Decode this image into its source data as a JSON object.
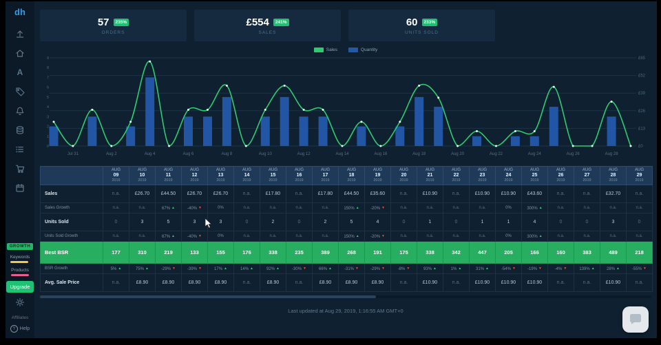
{
  "app": {
    "logo_text": "dh"
  },
  "sidebar": {
    "icons": [
      {
        "name": "upload-icon"
      },
      {
        "name": "home-icon"
      },
      {
        "name": "typography-icon"
      },
      {
        "name": "tag-icon"
      },
      {
        "name": "bell-icon"
      },
      {
        "name": "database-icon"
      },
      {
        "name": "list-icon"
      },
      {
        "name": "cart-icon"
      },
      {
        "name": "calendar-icon"
      }
    ],
    "growth_label": "GROWTH",
    "keywords_label": "Keywords",
    "products_label": "Products",
    "upgrade_label": "Upgrade",
    "affiliates_label": "Affiliates",
    "help_label": "Help"
  },
  "kpis": [
    {
      "value": "57",
      "badge": "235%",
      "label": "ORDERS"
    },
    {
      "value": "£554",
      "badge": "241%",
      "label": "SALES"
    },
    {
      "value": "60",
      "badge": "233%",
      "label": "UNITS SOLD"
    }
  ],
  "chart_data": {
    "type": "bar",
    "x": [
      "Jul 30",
      "Jul 31",
      "Aug 1",
      "Aug 2",
      "Aug 3",
      "Aug 4",
      "Aug 5",
      "Aug 6",
      "Aug 7",
      "Aug 8",
      "Aug 9",
      "Aug 10",
      "Aug 11",
      "Aug 12",
      "Aug 13",
      "Aug 14",
      "Aug 15",
      "Aug 16",
      "Aug 17",
      "Aug 18",
      "Aug 19",
      "Aug 20",
      "Aug 21",
      "Aug 22",
      "Aug 23",
      "Aug 24",
      "Aug 25",
      "Aug 26",
      "Aug 27",
      "Aug 28",
      "Aug 29"
    ],
    "x_ticks_shown": [
      "Jul 31",
      "Aug 2",
      "Aug 4",
      "Aug 6",
      "Aug 8",
      "Aug 10",
      "Aug 12",
      "Aug 14",
      "Aug 16",
      "Aug 18",
      "Aug 20",
      "Aug 22",
      "Aug 24",
      "Aug 26",
      "Aug 28"
    ],
    "series": [
      {
        "name": "Sales",
        "type": "line",
        "color": "#2ecc71",
        "values": [
          17.8,
          0,
          26.7,
          0,
          17.8,
          62.3,
          0,
          26.7,
          26.7,
          44.5,
          0,
          26.7,
          44.5,
          26.7,
          26.7,
          0,
          17.8,
          0,
          17.8,
          44.5,
          35.6,
          0,
          10.9,
          0,
          10.9,
          10.9,
          43.6,
          0,
          0,
          32.7,
          0
        ]
      },
      {
        "name": "Quantity",
        "type": "bar",
        "color": "#2459aa",
        "values": [
          2,
          0,
          3,
          0,
          2,
          7,
          0,
          3,
          3,
          5,
          0,
          3,
          5,
          3,
          3,
          0,
          2,
          0,
          2,
          5,
          4,
          0,
          1,
          0,
          1,
          1,
          4,
          0,
          0,
          3,
          0
        ]
      }
    ],
    "left_axis": {
      "min": 0,
      "max": 9,
      "ticks": [
        0,
        1,
        2,
        3,
        4,
        5,
        6,
        7,
        8,
        9
      ]
    },
    "right_axis": {
      "min": 0,
      "max": 65,
      "ticks": [
        0,
        13,
        26,
        39,
        52,
        65
      ],
      "prefix": "£"
    },
    "grid": true,
    "legend_position": "top"
  },
  "table": {
    "month": "AUG",
    "year": "2019",
    "dates": [
      "09",
      "10",
      "11",
      "12",
      "13",
      "14",
      "15",
      "16",
      "17",
      "18",
      "19",
      "20",
      "21",
      "22",
      "23",
      "24",
      "25",
      "26",
      "27",
      "28",
      "29"
    ],
    "rows": [
      {
        "label": "Sales",
        "type": "main",
        "cells": [
          {
            "t": "n.a."
          },
          {
            "t": "£26.70"
          },
          {
            "t": "£44.50"
          },
          {
            "t": "£26.70"
          },
          {
            "t": "£26.70"
          },
          {
            "t": "n.a."
          },
          {
            "t": "£17.80"
          },
          {
            "t": "n.a."
          },
          {
            "t": "£17.80"
          },
          {
            "t": "£44.50"
          },
          {
            "t": "£35.60"
          },
          {
            "t": "n.a."
          },
          {
            "t": "£10.90"
          },
          {
            "t": "n.a."
          },
          {
            "t": "£10.90"
          },
          {
            "t": "£10.90"
          },
          {
            "t": "£43.60"
          },
          {
            "t": "n.a."
          },
          {
            "t": "n.a."
          },
          {
            "t": "£32.70"
          },
          {
            "t": "n.a."
          }
        ]
      },
      {
        "label": "Sales Growth",
        "type": "growth",
        "cells": [
          {
            "t": "n.a."
          },
          {
            "t": "n.a."
          },
          {
            "t": "67%",
            "a": "up"
          },
          {
            "t": "-40%",
            "a": "down"
          },
          {
            "t": "0%"
          },
          {
            "t": "n.a."
          },
          {
            "t": "n.a."
          },
          {
            "t": "n.a."
          },
          {
            "t": "n.a."
          },
          {
            "t": "150%",
            "a": "up"
          },
          {
            "t": "-20%",
            "a": "down"
          },
          {
            "t": "n.a."
          },
          {
            "t": "n.a."
          },
          {
            "t": "n.a."
          },
          {
            "t": "n.a."
          },
          {
            "t": "0%"
          },
          {
            "t": "300%",
            "a": "up"
          },
          {
            "t": "n.a."
          },
          {
            "t": "n.a."
          },
          {
            "t": "n.a."
          },
          {
            "t": "n.a."
          }
        ]
      },
      {
        "label": "Units Sold",
        "type": "main",
        "cells": [
          {
            "t": "0"
          },
          {
            "t": "3"
          },
          {
            "t": "5"
          },
          {
            "t": "3"
          },
          {
            "t": "3"
          },
          {
            "t": "0"
          },
          {
            "t": "2"
          },
          {
            "t": "0"
          },
          {
            "t": "2"
          },
          {
            "t": "5"
          },
          {
            "t": "4"
          },
          {
            "t": "0"
          },
          {
            "t": "1"
          },
          {
            "t": "0"
          },
          {
            "t": "1"
          },
          {
            "t": "1"
          },
          {
            "t": "4"
          },
          {
            "t": "0"
          },
          {
            "t": "0"
          },
          {
            "t": "3"
          },
          {
            "t": "0"
          }
        ]
      },
      {
        "label": "Units Sold Growth",
        "type": "growth",
        "cells": [
          {
            "t": "n.a."
          },
          {
            "t": "n.a."
          },
          {
            "t": "67%",
            "a": "up"
          },
          {
            "t": "-40%",
            "a": "down"
          },
          {
            "t": "0%"
          },
          {
            "t": "n.a."
          },
          {
            "t": "n.a."
          },
          {
            "t": "n.a."
          },
          {
            "t": "n.a."
          },
          {
            "t": "150%",
            "a": "up"
          },
          {
            "t": "-20%",
            "a": "down"
          },
          {
            "t": "n.a."
          },
          {
            "t": "n.a."
          },
          {
            "t": "n.a."
          },
          {
            "t": "n.a."
          },
          {
            "t": "0%"
          },
          {
            "t": "300%",
            "a": "up"
          },
          {
            "t": "n.a."
          },
          {
            "t": "n.a."
          },
          {
            "t": "n.a."
          },
          {
            "t": "n.a."
          }
        ]
      },
      {
        "label": "Best BSR",
        "type": "bsr",
        "cells": [
          {
            "t": "177"
          },
          {
            "t": "310"
          },
          {
            "t": "219"
          },
          {
            "t": "133"
          },
          {
            "t": "155"
          },
          {
            "t": "176"
          },
          {
            "t": "338"
          },
          {
            "t": "235"
          },
          {
            "t": "389"
          },
          {
            "t": "268"
          },
          {
            "t": "191"
          },
          {
            "t": "175"
          },
          {
            "t": "338"
          },
          {
            "t": "342"
          },
          {
            "t": "447"
          },
          {
            "t": "205"
          },
          {
            "t": "166"
          },
          {
            "t": "160"
          },
          {
            "t": "383"
          },
          {
            "t": "489"
          },
          {
            "t": "218"
          }
        ]
      },
      {
        "label": "BSR Growth",
        "type": "growth",
        "cells": [
          {
            "t": "5%",
            "a": "up"
          },
          {
            "t": "75%",
            "a": "up"
          },
          {
            "t": "-29%",
            "a": "down"
          },
          {
            "t": "-39%",
            "a": "down"
          },
          {
            "t": "17%",
            "a": "up"
          },
          {
            "t": "14%",
            "a": "up"
          },
          {
            "t": "92%",
            "a": "up"
          },
          {
            "t": "-30%",
            "a": "down"
          },
          {
            "t": "66%",
            "a": "up"
          },
          {
            "t": "-31%",
            "a": "down"
          },
          {
            "t": "-29%",
            "a": "down"
          },
          {
            "t": "-8%",
            "a": "down"
          },
          {
            "t": "93%",
            "a": "up"
          },
          {
            "t": "1%",
            "a": "up"
          },
          {
            "t": "31%",
            "a": "up"
          },
          {
            "t": "-54%",
            "a": "down"
          },
          {
            "t": "-19%",
            "a": "down"
          },
          {
            "t": "-4%",
            "a": "down"
          },
          {
            "t": "139%",
            "a": "up"
          },
          {
            "t": "28%",
            "a": "up"
          },
          {
            "t": "-55%",
            "a": "down"
          }
        ]
      },
      {
        "label": "Avg. Sale Price",
        "type": "main",
        "cells": [
          {
            "t": "n.a."
          },
          {
            "t": "£8.90"
          },
          {
            "t": "£8.90"
          },
          {
            "t": "£8.90"
          },
          {
            "t": "£8.90"
          },
          {
            "t": "n.a."
          },
          {
            "t": "£8.90"
          },
          {
            "t": "n.a."
          },
          {
            "t": "£8.90"
          },
          {
            "t": "£8.90"
          },
          {
            "t": "£8.90"
          },
          {
            "t": "n.a."
          },
          {
            "t": "£10.90"
          },
          {
            "t": "n.a."
          },
          {
            "t": "£10.90"
          },
          {
            "t": "£10.90"
          },
          {
            "t": "£10.90"
          },
          {
            "t": "n.a."
          },
          {
            "t": "n.a."
          },
          {
            "t": "£10.90"
          },
          {
            "t": "n.a."
          }
        ]
      }
    ]
  },
  "footer": {
    "last_updated": "Last updated at Aug 29, 2019, 1:16:55 AM GMT+0"
  }
}
